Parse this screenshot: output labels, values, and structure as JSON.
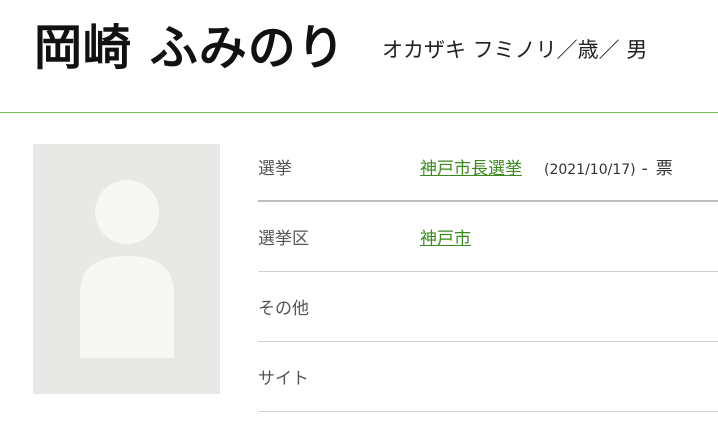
{
  "candidate": {
    "name": "岡崎 ふみのり",
    "kana_age_gender": "オカザキ フミノリ／歳／ 男"
  },
  "photo": {
    "icon": "person-placeholder-icon",
    "colors": {
      "background": "#e8e8e6",
      "figure": "#f7f7f5"
    }
  },
  "info": {
    "election": {
      "label": "選挙",
      "link": "神戸市長選挙",
      "date": "(2021/10/17)",
      "separator": "-",
      "votes": "票"
    },
    "district": {
      "label": "選挙区",
      "link": "神戸市"
    },
    "other": {
      "label": "その他",
      "value": ""
    },
    "site": {
      "label": "サイト",
      "value": ""
    }
  },
  "colors": {
    "accent_line": "#7cbf55",
    "link": "#3b8a1e"
  }
}
